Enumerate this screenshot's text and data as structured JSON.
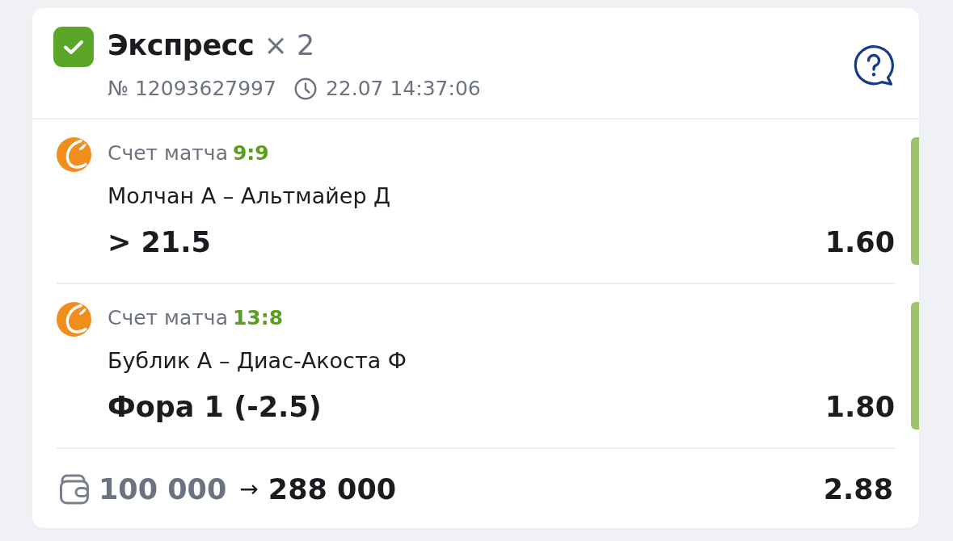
{
  "bet": {
    "won": true,
    "title": "Экспресс",
    "multiplier": "× 2",
    "number": "№ 12093627997",
    "datetime": "22.07 14:37:06"
  },
  "selections": [
    {
      "market": "Счет матча",
      "score": "9:9",
      "event": "Молчан А – Альтмайер Д",
      "outcome": "> 21.5",
      "odds": "1.60",
      "won": true
    },
    {
      "market": "Счет матча",
      "score": "13:8",
      "event": "Бублик А – Диас-Акоста Ф",
      "outcome": "Фора 1 (-2.5)",
      "odds": "1.80",
      "won": true
    }
  ],
  "footer": {
    "stake": "100 000",
    "arrow": "→",
    "payout": "288 000",
    "total_odds": "2.88"
  }
}
